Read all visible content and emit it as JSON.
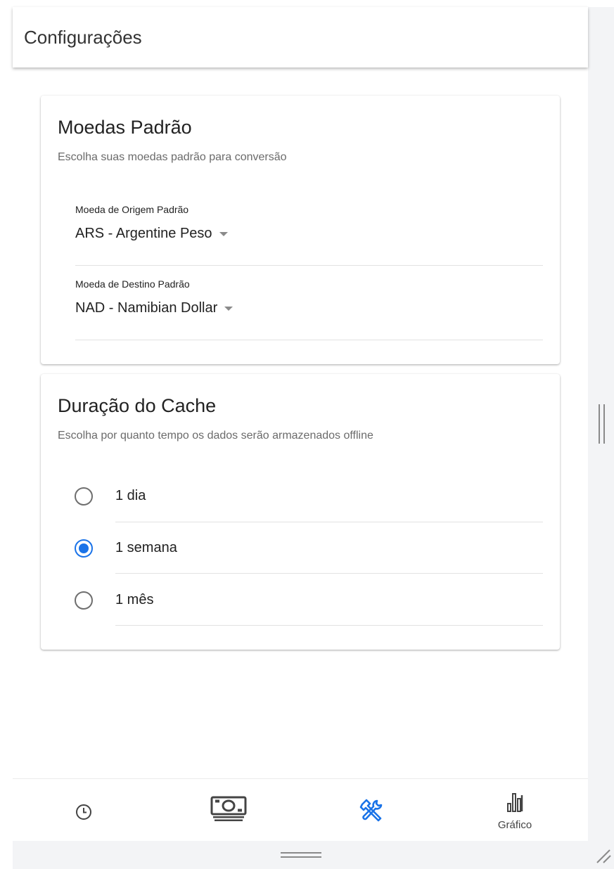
{
  "app_bar": {
    "title": "Configurações"
  },
  "default_currencies": {
    "title": "Moedas Padrão",
    "subtitle": "Escolha suas moedas padrão para conversão",
    "source": {
      "label": "Moeda de Origem Padrão",
      "value": "ARS - Argentine Peso"
    },
    "target": {
      "label": "Moeda de Destino Padrão",
      "value": "NAD - Namibian Dollar"
    }
  },
  "cache_duration": {
    "title": "Duração do Cache",
    "subtitle": "Escolha por quanto tempo os dados serão armazenados offline",
    "options": [
      {
        "label": "1 dia",
        "selected": false
      },
      {
        "label": "1 semana",
        "selected": true
      },
      {
        "label": "1 mês",
        "selected": false
      }
    ]
  },
  "bottom_nav": {
    "items": [
      {
        "icon": "clock-icon",
        "label": "",
        "active": false
      },
      {
        "icon": "money-icon",
        "label": "",
        "active": false
      },
      {
        "icon": "tools-icon",
        "label": "",
        "active": true
      },
      {
        "icon": "bar-chart-icon",
        "label": "Gráfico",
        "active": false
      }
    ]
  },
  "colors": {
    "accent": "#1a73e8",
    "icon_default": "#444444",
    "divider": "#e2e2e2",
    "subtitle": "#6b6b6b"
  }
}
